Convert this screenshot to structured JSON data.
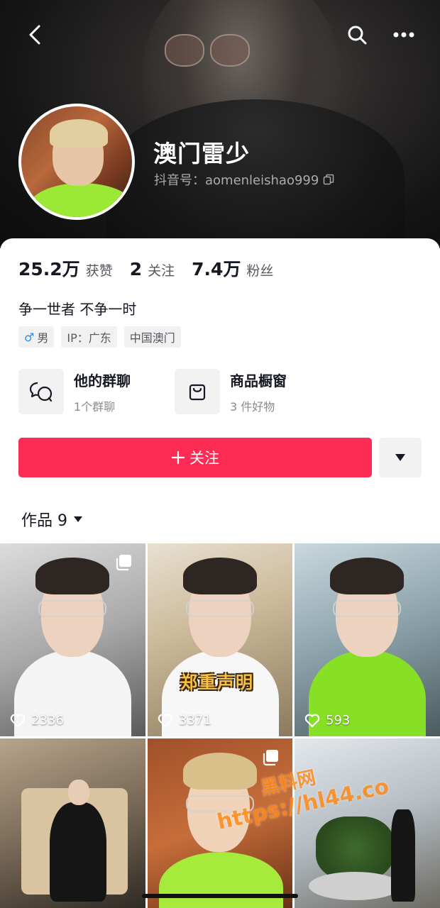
{
  "profile": {
    "name": "澳门雷少",
    "handle": "抖音号：aomenleishao999"
  },
  "stats": [
    {
      "num": "25.2万",
      "label": "获赞"
    },
    {
      "num": "2",
      "label": "关注"
    },
    {
      "num": "7.4万",
      "label": "粉丝"
    }
  ],
  "bio": "争一世者 不争一时",
  "tags": {
    "gender": "男",
    "gender_icon": "♂",
    "ip": "IP：广东",
    "location": "中国澳门"
  },
  "features": {
    "group": {
      "title": "他的群聊",
      "sub": "1个群聊"
    },
    "shop": {
      "title": "商品橱窗",
      "sub": "3 件好物"
    }
  },
  "follow_button": "关注",
  "works_tab": "作品 9",
  "videos": [
    {
      "likes": "2336"
    },
    {
      "likes": "3371",
      "caption": "郑重声明"
    },
    {
      "likes": "593"
    }
  ],
  "watermark": {
    "line1": "黑料网",
    "line2": "https://hl44.co"
  },
  "colors": {
    "accent": "#fe2c55",
    "text": "#161823"
  }
}
